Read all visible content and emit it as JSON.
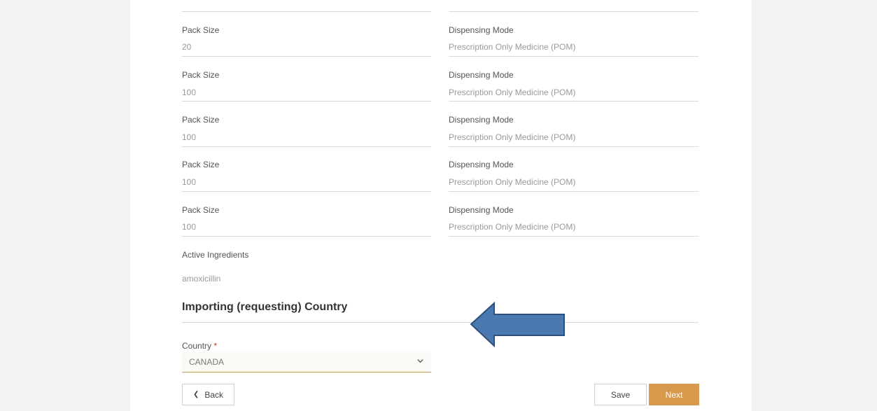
{
  "rows": [
    {
      "pack_size_label": "Pack Size",
      "pack_size_value": "20",
      "dispensing_label": "Dispensing Mode",
      "dispensing_value": "Prescription Only Medicine (POM)"
    },
    {
      "pack_size_label": "Pack Size",
      "pack_size_value": "100",
      "dispensing_label": "Dispensing Mode",
      "dispensing_value": "Prescription Only Medicine (POM)"
    },
    {
      "pack_size_label": "Pack Size",
      "pack_size_value": "100",
      "dispensing_label": "Dispensing Mode",
      "dispensing_value": "Prescription Only Medicine (POM)"
    },
    {
      "pack_size_label": "Pack Size",
      "pack_size_value": "100",
      "dispensing_label": "Dispensing Mode",
      "dispensing_value": "Prescription Only Medicine (POM)"
    },
    {
      "pack_size_label": "Pack Size",
      "pack_size_value": "100",
      "dispensing_label": "Dispensing Mode",
      "dispensing_value": "Prescription Only Medicine (POM)"
    }
  ],
  "active_ingredients": {
    "label": "Active Ingredients",
    "value": "amoxicillin"
  },
  "section": {
    "title": "Importing (requesting) Country"
  },
  "country": {
    "label": "Country",
    "required_mark": "*",
    "selected": "CANADA"
  },
  "buttons": {
    "back": "Back",
    "save": "Save",
    "next": "Next"
  },
  "colors": {
    "accent": "#d79a4c",
    "arrow_fill": "#4a78b0",
    "arrow_stroke": "#2f4f7a"
  }
}
